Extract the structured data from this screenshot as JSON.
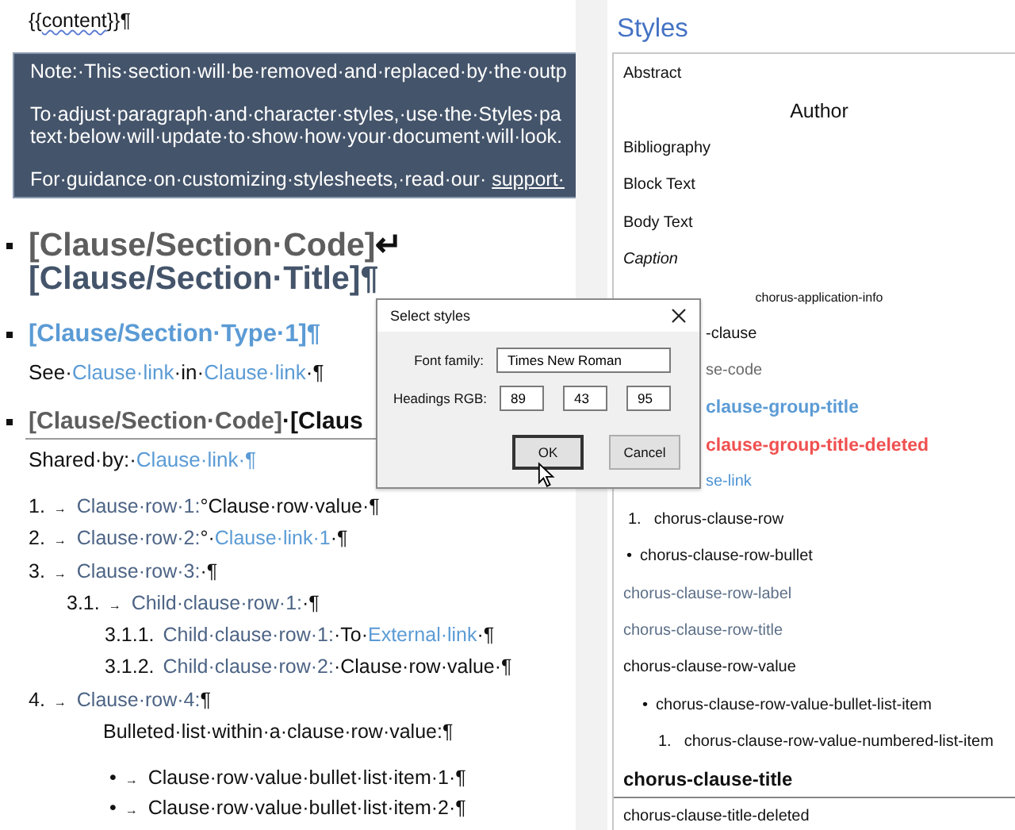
{
  "document": {
    "blocks": [
      {
        "kind": "template",
        "lines": [
          [
            {
              "kind": "plain",
              "text": "{{"
            },
            {
              "kind": "field",
              "text": "content"
            },
            {
              "kind": "plain",
              "text": "}}¶"
            }
          ]
        ]
      },
      {
        "kind": "note",
        "paragraphs": [
          {
            "lines": [
              "Note:·This·section·will·be·removed·and·replaced·by·the·outp"
            ]
          },
          {
            "lines": [
              "To·adjust·paragraph·and·character·styles,·use·the·Styles·pa",
              "text·below·will·update·to·show·how·your·document·will·look."
            ]
          },
          {
            "lines": [
              "For·guidance·on·customizing·stylesheets,·read·our·"
            ],
            "link": "support·"
          }
        ]
      },
      {
        "kind": "heading",
        "lines": [
          [
            {
              "kind": "code",
              "text": "[Clause/Section·Code]"
            },
            {
              "kind": "mark",
              "text": "↵"
            }
          ],
          [
            {
              "kind": "title",
              "text": "[Clause/Section·Title]¶"
            }
          ]
        ]
      },
      {
        "kind": "type-heading",
        "lines": [
          [
            {
              "kind": "link",
              "text": "[Clause/Section·Type·1]¶"
            }
          ]
        ]
      },
      {
        "kind": "text",
        "lines": [
          [
            {
              "kind": "plain",
              "text": "See·"
            },
            {
              "kind": "link",
              "text": "Clause·link"
            },
            {
              "kind": "plain",
              "text": "·in·"
            },
            {
              "kind": "link",
              "text": "Clause·link"
            },
            {
              "kind": "plain",
              "text": "·¶"
            }
          ]
        ]
      },
      {
        "kind": "section-heading",
        "lines": [
          [
            {
              "kind": "code",
              "text": "[Clause/Section·Code]"
            },
            {
              "kind": "plain",
              "text": "·[Claus"
            }
          ]
        ]
      },
      {
        "kind": "text",
        "lines": [
          [
            {
              "kind": "plain",
              "text": "Shared·by:·"
            },
            {
              "kind": "link",
              "text": "Clause·link·¶"
            }
          ]
        ]
      },
      {
        "kind": "rows",
        "rows": [
          {
            "kind": "row",
            "number": "1.",
            "tab": "→",
            "segments": [
              {
                "kind": "ref",
                "text": "Clause·row·1:"
              },
              {
                "kind": "plain",
                "text": "°Clause·row·value·¶"
              }
            ]
          },
          {
            "kind": "row",
            "number": "2.",
            "tab": "→",
            "segments": [
              {
                "kind": "ref",
                "text": "Clause·row·2:"
              },
              {
                "kind": "plain",
                "text": "°·"
              },
              {
                "kind": "link",
                "text": "Clause·link·1"
              },
              {
                "kind": "plain",
                "text": "·¶"
              }
            ]
          },
          {
            "kind": "row",
            "number": "3.",
            "tab": "→",
            "segments": [
              {
                "kind": "ref",
                "text": "Clause·row·3:"
              },
              {
                "kind": "plain",
                "text": "·¶"
              }
            ],
            "children": [
              {
                "kind": "row",
                "number": "3.1.",
                "tab": "→",
                "segments": [
                  {
                    "kind": "ref",
                    "text": "Child·clause·row·1:"
                  },
                  {
                    "kind": "plain",
                    "text": "·¶"
                  }
                ],
                "children": [
                  {
                    "kind": "row",
                    "number": "3.1.1.",
                    "segments": [
                      {
                        "kind": "ref",
                        "text": "Child·clause·row·1:"
                      },
                      {
                        "kind": "plain",
                        "text": "·To·"
                      },
                      {
                        "kind": "link",
                        "text": "External·link"
                      },
                      {
                        "kind": "plain",
                        "text": "·¶"
                      }
                    ]
                  },
                  {
                    "kind": "row",
                    "number": "3.1.2.",
                    "segments": [
                      {
                        "kind": "ref",
                        "text": "Child·clause·row·2:"
                      },
                      {
                        "kind": "plain",
                        "text": "·Clause·row·value·¶"
                      }
                    ]
                  }
                ]
              }
            ]
          },
          {
            "kind": "row",
            "number": "4.",
            "tab": "→",
            "segments": [
              {
                "kind": "ref",
                "text": "Clause·row·4:"
              },
              {
                "kind": "plain",
                "text": "¶"
              }
            ],
            "children": [
              {
                "kind": "paragraph",
                "segments": [
                  {
                    "kind": "plain",
                    "text": "Bulleted·list·within·a·clause·row·value:¶"
                  }
                ]
              },
              {
                "kind": "bullet",
                "marker": "•",
                "tab": "→",
                "segments": [
                  {
                    "kind": "plain",
                    "text": "Clause·row·value·bullet·list·item·1·¶"
                  }
                ]
              },
              {
                "kind": "bullet",
                "marker": "•",
                "tab": "→",
                "segments": [
                  {
                    "kind": "plain",
                    "text": "Clause·row·value·bullet·list·item·2·¶"
                  }
                ]
              }
            ]
          }
        ]
      }
    ]
  },
  "styles_pane": {
    "title": "Styles",
    "items": [
      {
        "label": "Abstract",
        "kind": "normal"
      },
      {
        "label": "Author",
        "kind": "author"
      },
      {
        "label": "Bibliography",
        "kind": "normal"
      },
      {
        "label": "Block Text",
        "kind": "normal"
      },
      {
        "label": "Body Text",
        "kind": "normal"
      },
      {
        "label": "Caption",
        "kind": "italic"
      },
      {
        "label": "chorus-application-info",
        "kind": "app-info"
      },
      {
        "label": "-clause",
        "kind": "normal",
        "clipped": true
      },
      {
        "label": "se-code",
        "kind": "gray",
        "clipped": true
      },
      {
        "label": "clause-group-title",
        "kind": "group-title",
        "clipped": true
      },
      {
        "label": "clause-group-title-deleted",
        "kind": "deleted",
        "clipped": true
      },
      {
        "label": "se-link",
        "kind": "link",
        "clipped": true
      },
      {
        "label": "chorus-clause-row",
        "kind": "numbered",
        "marker": "1."
      },
      {
        "label": "chorus-clause-row-bullet",
        "kind": "bullet",
        "marker": "•"
      },
      {
        "label": "chorus-clause-row-label",
        "kind": "label"
      },
      {
        "label": "chorus-clause-row-title",
        "kind": "label"
      },
      {
        "label": "chorus-clause-row-value",
        "kind": "normal"
      },
      {
        "label": "chorus-clause-row-value-bullet-list-item",
        "kind": "bullet-item",
        "marker": "•"
      },
      {
        "label": "chorus-clause-row-value-numbered-list-item",
        "kind": "numbered-item",
        "marker": "1."
      },
      {
        "label": "chorus-clause-title",
        "kind": "heading"
      },
      {
        "label": "chorus-clause-title-deleted",
        "kind": "normal"
      }
    ]
  },
  "dialog": {
    "title": "Select styles",
    "fields": [
      {
        "label": "Font family:",
        "values": [
          "Times New Roman"
        ]
      },
      {
        "label": "Headings RGB:",
        "values": [
          "89",
          "43",
          "95"
        ]
      }
    ],
    "buttons": [
      {
        "label": "OK",
        "focused": true
      },
      {
        "label": "Cancel",
        "focused": false
      }
    ]
  }
}
